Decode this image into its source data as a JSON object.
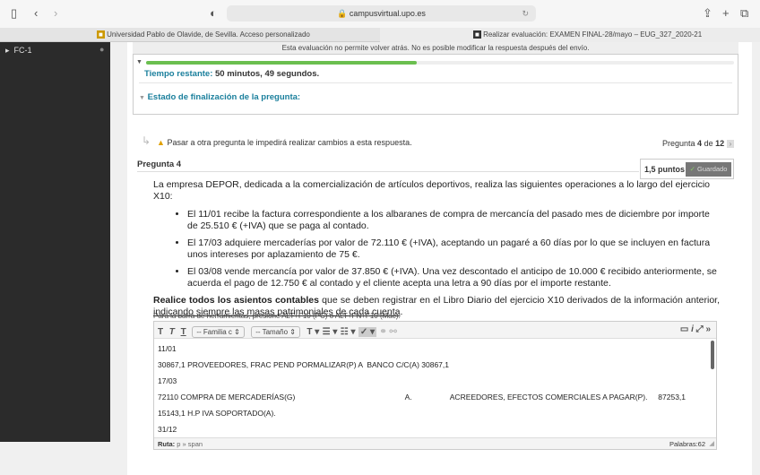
{
  "browser": {
    "url": "campusvirtual.upo.es",
    "tabs": [
      "Universidad Pablo de Olavide, de Sevilla. Acceso personalizado",
      "Realizar evaluación: EXAMEN FINAL-28/mayo – EUG_327_2020-21"
    ]
  },
  "sidebar": {
    "items": [
      {
        "label": "FC-1"
      }
    ]
  },
  "notice": "Esta evaluación no permite volver atrás. No es posible modificar la respuesta después del envío.",
  "timer": {
    "label": "Tiempo restante:",
    "value": "50 minutos, 49 segundos.",
    "progress_percent": 46
  },
  "status_heading": "Estado de finalización de la pregunta:",
  "warning": "Pasar a otra pregunta le impedirá realizar cambios a esta respuesta.",
  "pager": {
    "prefix": "Pregunta",
    "current": "4",
    "of": "de",
    "total": "12"
  },
  "question": {
    "title": "Pregunta 4",
    "points": "1,5 puntos",
    "status": "Guardado",
    "intro": "La empresa DEPOR, dedicada a la comercialización de artículos deportivos, realiza las siguientes operaciones a lo largo del ejercicio X10:",
    "bullets": [
      "El 11/01 recibe la factura correspondiente a los albaranes de compra de mercancía del pasado mes de diciembre por importe de 25.510 € (+IVA) que se paga al contado.",
      "El 17/03 adquiere mercaderías por valor de 72.110 € (+IVA), aceptando un pagaré a 60 días por lo que se incluyen en factura unos intereses por aplazamiento de 75 €.",
      "El 03/08 vende mercancía por valor de 37.850 € (+IVA). Una vez descontado el anticipo de 10.000 € recibido anteriormente, se acuerda el pago de 12.750 € al contado y el cliente acepta una letra a 90 días por el importe restante."
    ],
    "instr_bold": "Realice todos los asientos contables",
    "instr_mid": " que se deben registrar en el Libro Diario del ejercicio X10 derivados de la información anterior, ",
    "instr_under": "indicando siempre las masas patrimoniales de cada cuenta",
    "instr_end": "."
  },
  "editor": {
    "hint": "Para la barra de herramientas, presione ALT+F10 (PC) o ALT+FN+F10 (Mac).",
    "font_family": "-- Familia c",
    "font_size": "-- Tamaño",
    "lines": [
      "11/01",
      "30867,1 PROVEEDORES, FRAC PEND PORMALIZAR(P) A  BANCO C/C(A) 30867,1",
      "17/03",
      "72110 COMPRA DE MERCADERÍAS(G)                                                    A.                  ACREEDORES, EFECTOS COMERCIALES A PAGAR(P).     87253,1",
      "15143,1 H.P IVA SOPORTADO(A).",
      "31/12"
    ],
    "path_label": "Ruta:",
    "path": "p » span",
    "words": "Palabras:62"
  }
}
